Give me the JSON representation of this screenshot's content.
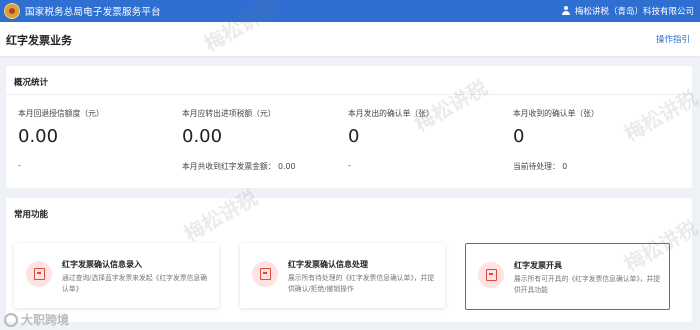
{
  "topbar": {
    "title": "国家税务总局电子发票服务平台",
    "user": "梅松讲税（青岛）科技有限公司"
  },
  "header": {
    "title": "红字发票业务",
    "guide": "操作指引"
  },
  "overview": {
    "title": "概况统计",
    "stats": [
      {
        "label": "本月回退授信额度（元）",
        "value": "0.00",
        "sub": "-"
      },
      {
        "label": "本月应转出进项税额（元）",
        "value": "0.00",
        "sub": "本月共收到红字发票金额： 0.00"
      },
      {
        "label": "本月发出的确认单（张）",
        "value": "0",
        "sub": "-"
      },
      {
        "label": "本月收到的确认单（张）",
        "value": "0",
        "sub": "当前待处理： 0"
      }
    ]
  },
  "common": {
    "title": "常用功能",
    "functions": [
      {
        "name": "红字发票确认信息录入",
        "desc": "通过查询/选择蓝字发票来发起《红字发票信息确认单》"
      },
      {
        "name": "红字发票确认信息处理",
        "desc": "展示所有待处理的《红字发票信息确认单》，并提供确认/拒绝/撤销操作"
      },
      {
        "name": "红字发票开具",
        "desc": "展示所有可开具的《红字发票信息确认单》，并提供开具功能"
      }
    ]
  },
  "watermark_text": "梅松讲税",
  "brand_text": "大职跨境",
  "colors": {
    "topbar": "#2f6fd1",
    "highlight": "#e23b3b",
    "icon": "#e0483e"
  }
}
